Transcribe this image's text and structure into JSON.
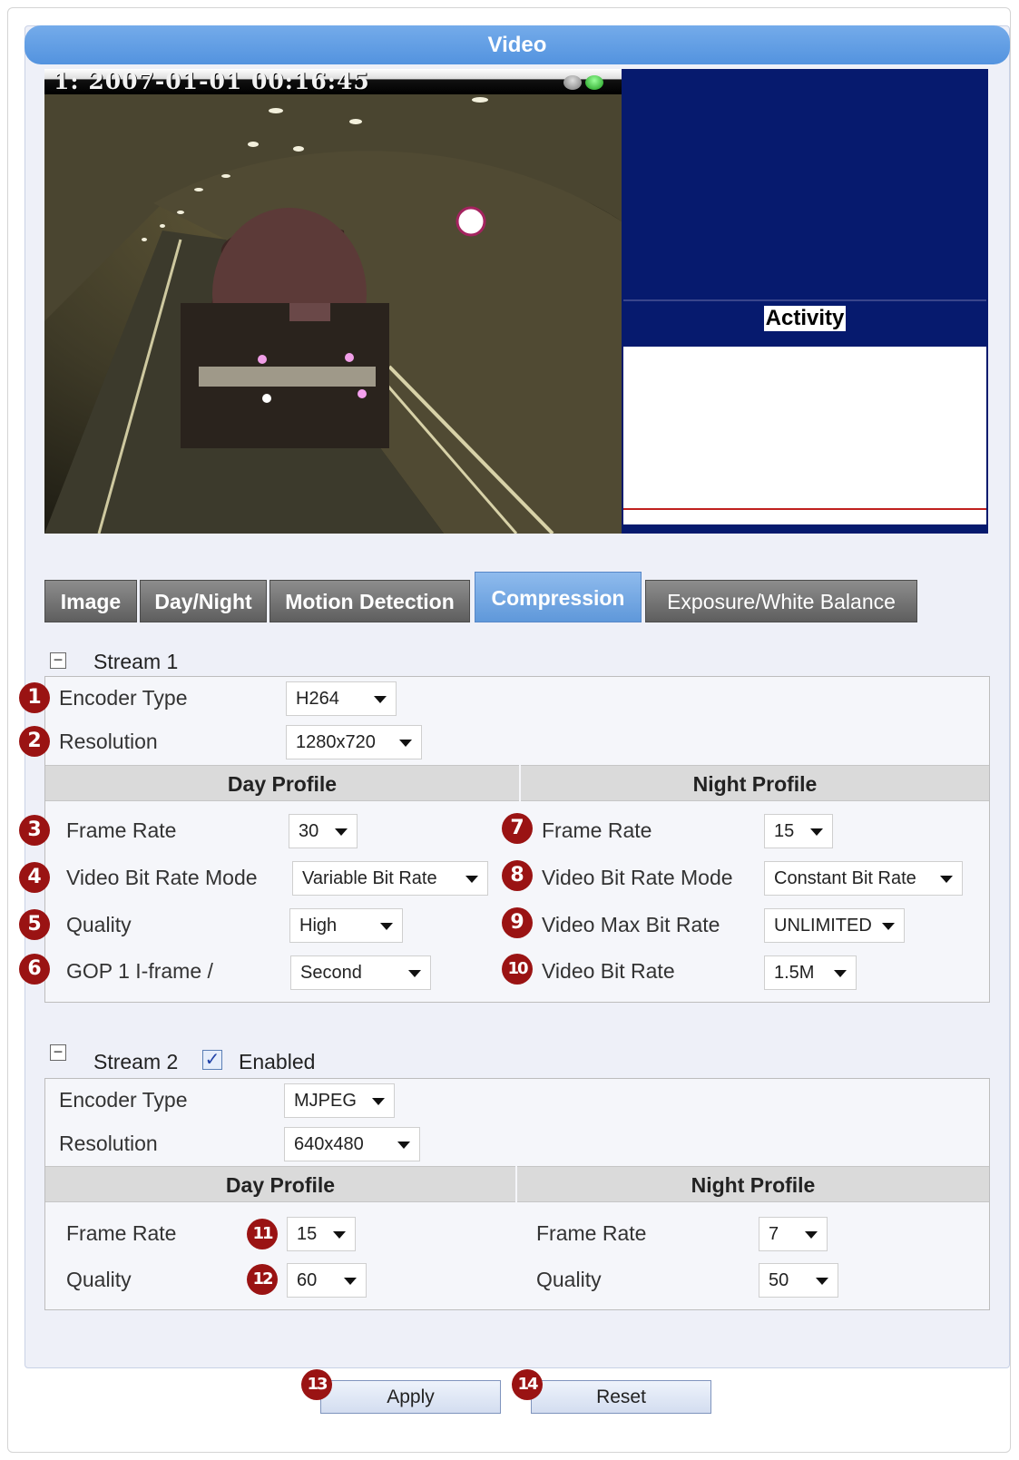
{
  "page": {
    "title": "Video"
  },
  "video": {
    "overlay": "1:  2007-01-01 00:16:45"
  },
  "activity": {
    "label": "Activity"
  },
  "tabs": [
    {
      "label": "Image"
    },
    {
      "label": "Day/Night"
    },
    {
      "label": "Motion Detection"
    },
    {
      "label": "Compression",
      "active": true
    },
    {
      "label": "Exposure/White Balance"
    }
  ],
  "stream1": {
    "title": "Stream 1",
    "encoder_type": {
      "label": "Encoder Type",
      "value": "H264"
    },
    "resolution": {
      "label": "Resolution",
      "value": "1280x720"
    },
    "day_header": "Day Profile",
    "night_header": "Night Profile",
    "day": {
      "frame_rate": {
        "label": "Frame Rate",
        "value": "30"
      },
      "bit_rate_mode": {
        "label": "Video Bit Rate Mode",
        "value": "Variable Bit Rate"
      },
      "quality": {
        "label": "Quality",
        "value": "High"
      },
      "gop": {
        "label": "GOP 1 I-frame /",
        "value": "Second"
      }
    },
    "night": {
      "frame_rate": {
        "label": "Frame Rate",
        "value": "15"
      },
      "bit_rate_mode": {
        "label": "Video Bit Rate Mode",
        "value": "Constant Bit Rate"
      },
      "max_bit_rate": {
        "label": "Video Max Bit Rate",
        "value": "UNLIMITED"
      },
      "bit_rate": {
        "label": "Video Bit Rate",
        "value": "1.5M"
      }
    }
  },
  "stream2": {
    "title": "Stream 2",
    "enabled_label": "Enabled",
    "enabled": true,
    "encoder_type": {
      "label": "Encoder Type",
      "value": "MJPEG"
    },
    "resolution": {
      "label": "Resolution",
      "value": "640x480"
    },
    "day_header": "Day Profile",
    "night_header": "Night Profile",
    "day": {
      "frame_rate": {
        "label": "Frame Rate",
        "value": "15"
      },
      "quality": {
        "label": "Quality",
        "value": "60"
      }
    },
    "night": {
      "frame_rate": {
        "label": "Frame Rate",
        "value": "7"
      },
      "quality": {
        "label": "Quality",
        "value": "50"
      }
    }
  },
  "badges": [
    "1",
    "2",
    "3",
    "4",
    "5",
    "6",
    "7",
    "8",
    "9",
    "10",
    "11",
    "12",
    "13",
    "14"
  ],
  "buttons": {
    "apply": "Apply",
    "reset": "Reset"
  },
  "colors": {
    "title_bar": "#5393df",
    "active_tab": "#5f98da",
    "badge": "#9a1313",
    "activity_bg": "#061a6e"
  }
}
